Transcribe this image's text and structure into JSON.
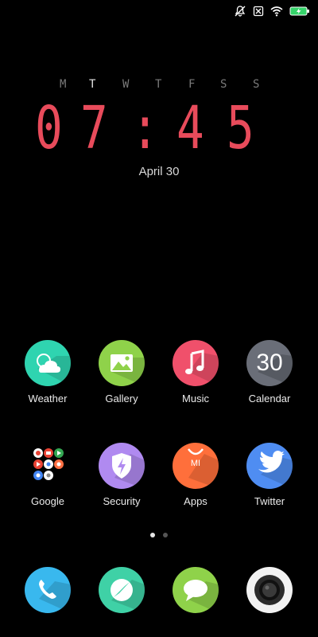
{
  "weekdays": [
    "M",
    "T",
    "W",
    "T",
    "F",
    "S",
    "S"
  ],
  "active_weekday_index": 1,
  "clock": {
    "h1": "0",
    "h2": "7",
    "colon": ":",
    "m1": "4",
    "m2": "5"
  },
  "date": "April 30",
  "apps_row1": [
    {
      "label": "Weather",
      "color": "#2fd4b0",
      "icon": "weather-icon"
    },
    {
      "label": "Gallery",
      "color": "#8fd24a",
      "icon": "gallery-icon"
    },
    {
      "label": "Music",
      "color": "#f0506b",
      "icon": "music-icon"
    },
    {
      "label": "Calendar",
      "color": "#6a6e78",
      "icon": "calendar-icon",
      "icon_text": "30"
    }
  ],
  "apps_row2": [
    {
      "label": "Google",
      "icon": "google-folder-icon"
    },
    {
      "label": "Security",
      "color": "#b08af0",
      "icon": "security-icon"
    },
    {
      "label": "Apps",
      "color": "#ff6f3b",
      "icon": "apps-icon",
      "icon_text": "MI"
    },
    {
      "label": "Twitter",
      "color": "#4f8df2",
      "icon": "twitter-icon"
    }
  ],
  "dock": [
    {
      "name": "phone",
      "color": "#39b8ee",
      "icon": "phone-icon"
    },
    {
      "name": "browser",
      "color": "#3fd1a6",
      "icon": "browser-icon"
    },
    {
      "name": "messages",
      "color": "#8fd24a",
      "icon": "messages-icon"
    },
    {
      "name": "camera",
      "color": "#f2f2f2",
      "icon": "camera-icon"
    }
  ],
  "page_dots": {
    "count": 2,
    "active": 0
  }
}
